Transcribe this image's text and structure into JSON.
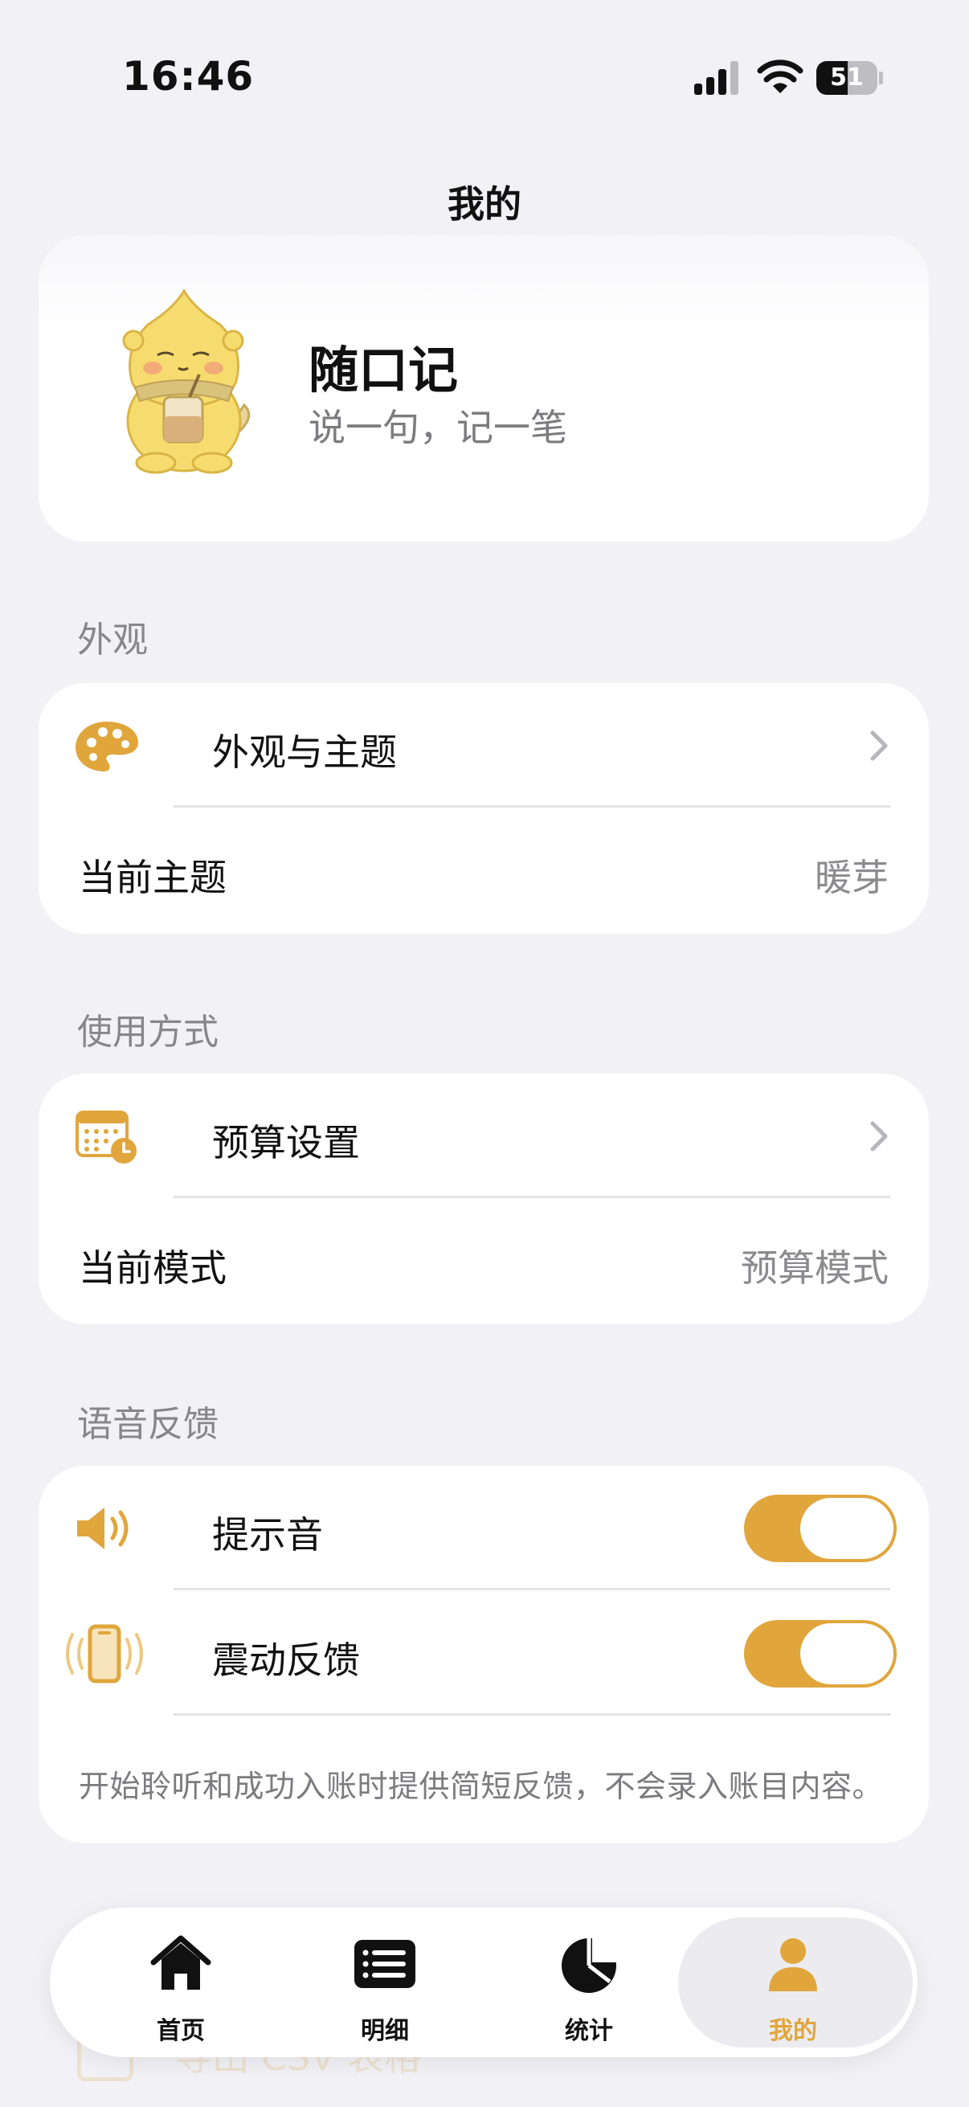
{
  "status_bar": {
    "time": "16:46",
    "battery_level": "51",
    "battery_fraction": 0.51
  },
  "header": {
    "title": "我的"
  },
  "profile": {
    "app_name": "随口记",
    "slogan": "说一句，记一笔",
    "mascot_icon": "mascot-character-icon"
  },
  "sections": {
    "appearance": {
      "label": "外观",
      "theme_row": {
        "title": "外观与主题",
        "icon": "palette-icon"
      },
      "current_theme": {
        "title": "当前主题",
        "value": "暖芽"
      }
    },
    "usage": {
      "label": "使用方式",
      "budget_row": {
        "title": "预算设置",
        "icon": "calendar-clock-icon"
      },
      "current_mode": {
        "title": "当前模式",
        "value": "预算模式"
      }
    },
    "voice_feedback": {
      "label": "语音反馈",
      "sound_row": {
        "title": "提示音",
        "icon": "speaker-icon",
        "enabled": true
      },
      "vibration_row": {
        "title": "震动反馈",
        "icon": "phone-vibrate-icon",
        "enabled": true
      },
      "footnote": "开始聆听和成功入账时提供简短反馈，不会录入账目内容。"
    }
  },
  "obscured_row": {
    "title": "导出 CSV 表格"
  },
  "tab_bar": {
    "tabs": [
      {
        "label": "首页",
        "icon": "home-icon",
        "active": false
      },
      {
        "label": "明细",
        "icon": "list-icon",
        "active": false
      },
      {
        "label": "统计",
        "icon": "pie-chart-icon",
        "active": false
      },
      {
        "label": "我的",
        "icon": "person-icon",
        "active": true
      }
    ]
  },
  "colors": {
    "accent": "#e0a63c",
    "background": "#f1f1f6",
    "card": "#ffffff",
    "secondary_text": "#86868b"
  }
}
